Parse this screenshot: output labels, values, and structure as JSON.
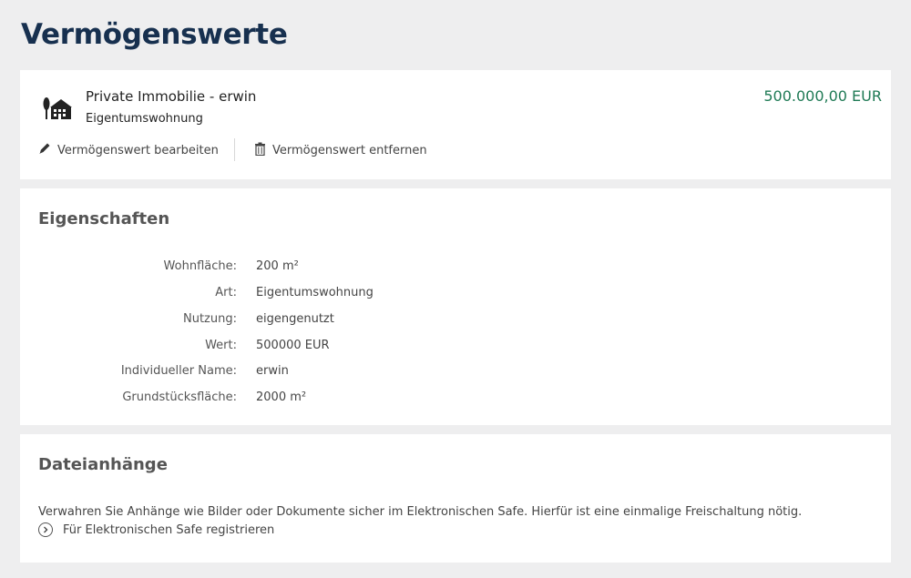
{
  "page": {
    "title": "Vermögenswerte"
  },
  "asset": {
    "name": "Private Immobilie - erwin",
    "type": "Eigentumswohnung",
    "value": "500.000,00 EUR",
    "icon": "house-with-tree-icon",
    "actions": {
      "edit_label": "Vermögenswert bearbeiten",
      "remove_label": "Vermögenswert entfernen"
    }
  },
  "properties": {
    "heading": "Eigenschaften",
    "rows": [
      {
        "label": "Wohnfläche:",
        "value": "200 m²"
      },
      {
        "label": "Art:",
        "value": "Eigentumswohnung"
      },
      {
        "label": "Nutzung:",
        "value": "eigengenutzt"
      },
      {
        "label": "Wert:",
        "value": "500000 EUR"
      },
      {
        "label": "Individueller Name:",
        "value": "erwin"
      },
      {
        "label": "Grundstücksfläche:",
        "value": "2000 m²"
      }
    ]
  },
  "attachments": {
    "heading": "Dateianhänge",
    "text": "Verwahren Sie Anhänge wie Bilder oder Dokumente sicher im Elektronischen Safe. Hierfür ist eine einmalige Freischaltung nötig.",
    "register_label": "Für Elektronischen Safe registrieren"
  },
  "colors": {
    "title": "#17304f",
    "value": "#1f7a55",
    "background": "#eeeeef"
  }
}
